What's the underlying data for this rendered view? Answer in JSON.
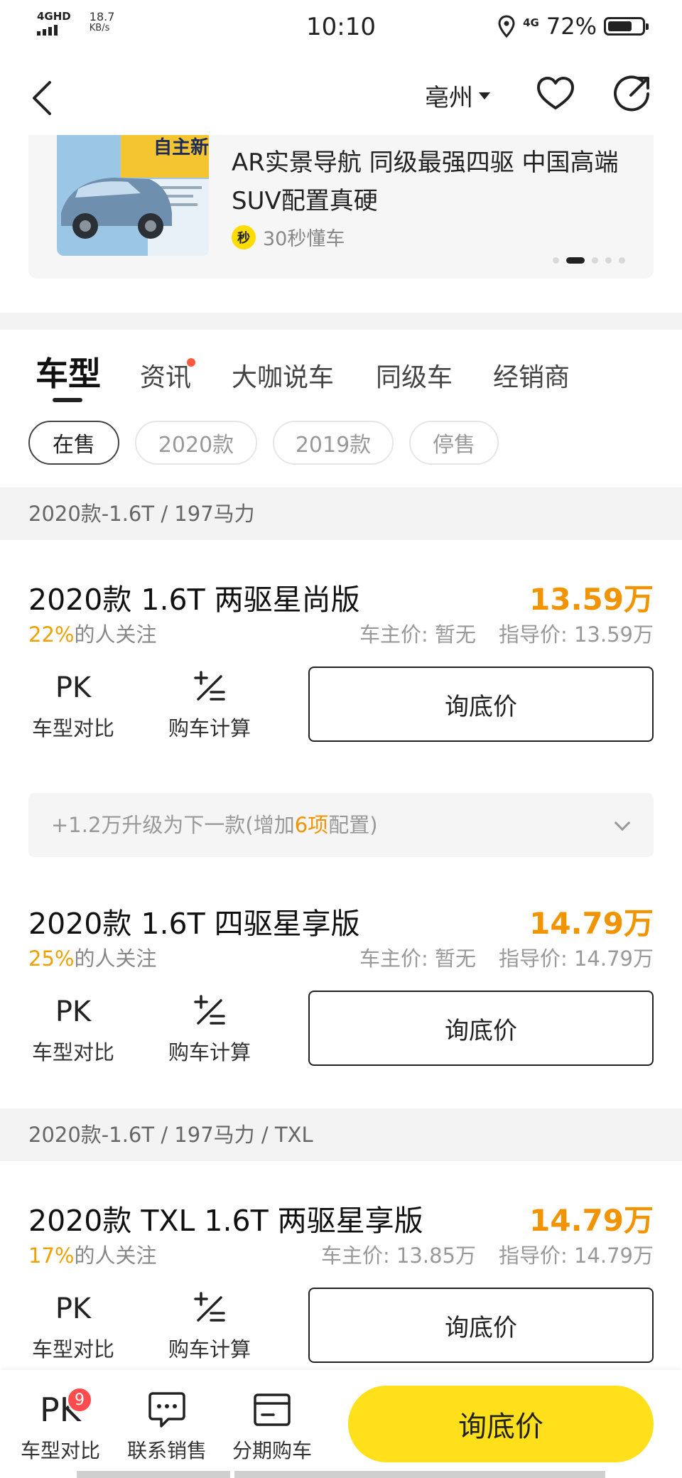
{
  "status_bar": {
    "network": "4GHD",
    "speed_value": "18.7",
    "speed_unit": "KB/s",
    "time": "10:10",
    "signal_type": "4G",
    "battery": "72%"
  },
  "header": {
    "city": "亳州"
  },
  "banner": {
    "thumb_text": "自主新标",
    "title": "AR实景导航 同级最强四驱 中国高端SUV配置真硬",
    "source_logo": "秒",
    "source": "30秒懂车"
  },
  "tabs": [
    {
      "label": "车型"
    },
    {
      "label": "资讯"
    },
    {
      "label": "大咖说车"
    },
    {
      "label": "同级车"
    },
    {
      "label": "经销商"
    }
  ],
  "filters": [
    {
      "label": "在售"
    },
    {
      "label": "2020款"
    },
    {
      "label": "2019款"
    },
    {
      "label": "停售"
    }
  ],
  "groups": [
    {
      "header": "2020款-1.6T / 197马力"
    },
    {
      "header": "2020款-1.6T / 197马力 / TXL"
    }
  ],
  "trims": [
    {
      "name": "2020款 1.6T 两驱星尚版",
      "price": "13.59万",
      "attention_pct": "22%",
      "attention_suffix": "的人关注",
      "owner_price": "车主价: 暂无",
      "guide_price": "指导价: 13.59万"
    },
    {
      "name": "2020款 1.6T 四驱星享版",
      "price": "14.79万",
      "attention_pct": "25%",
      "attention_suffix": "的人关注",
      "owner_price": "车主价: 暂无",
      "guide_price": "指导价: 14.79万"
    },
    {
      "name": "2020款 TXL 1.6T 两驱星享版",
      "price": "14.79万",
      "attention_pct": "17%",
      "attention_suffix": "的人关注",
      "owner_price": "车主价: 13.85万",
      "guide_price": "指导价: 14.79万"
    }
  ],
  "actions": {
    "pk_icon": "PK",
    "pk_label": "车型对比",
    "calc_label": "购车计算",
    "inquiry_label": "询底价"
  },
  "upgrade": {
    "prefix": "+1.2万升级为下一款(增加",
    "count": "6项",
    "suffix": "配置)"
  },
  "bottom_bar": {
    "pk_icon": "PK",
    "pk_badge": "9",
    "pk_label": "车型对比",
    "contact_label": "联系销售",
    "installment_label": "分期购车",
    "cta_label": "询底价"
  },
  "colors": {
    "price_orange": "#f29400",
    "cta_yellow": "#ffe01a",
    "badge_red": "#ff4d4f"
  }
}
